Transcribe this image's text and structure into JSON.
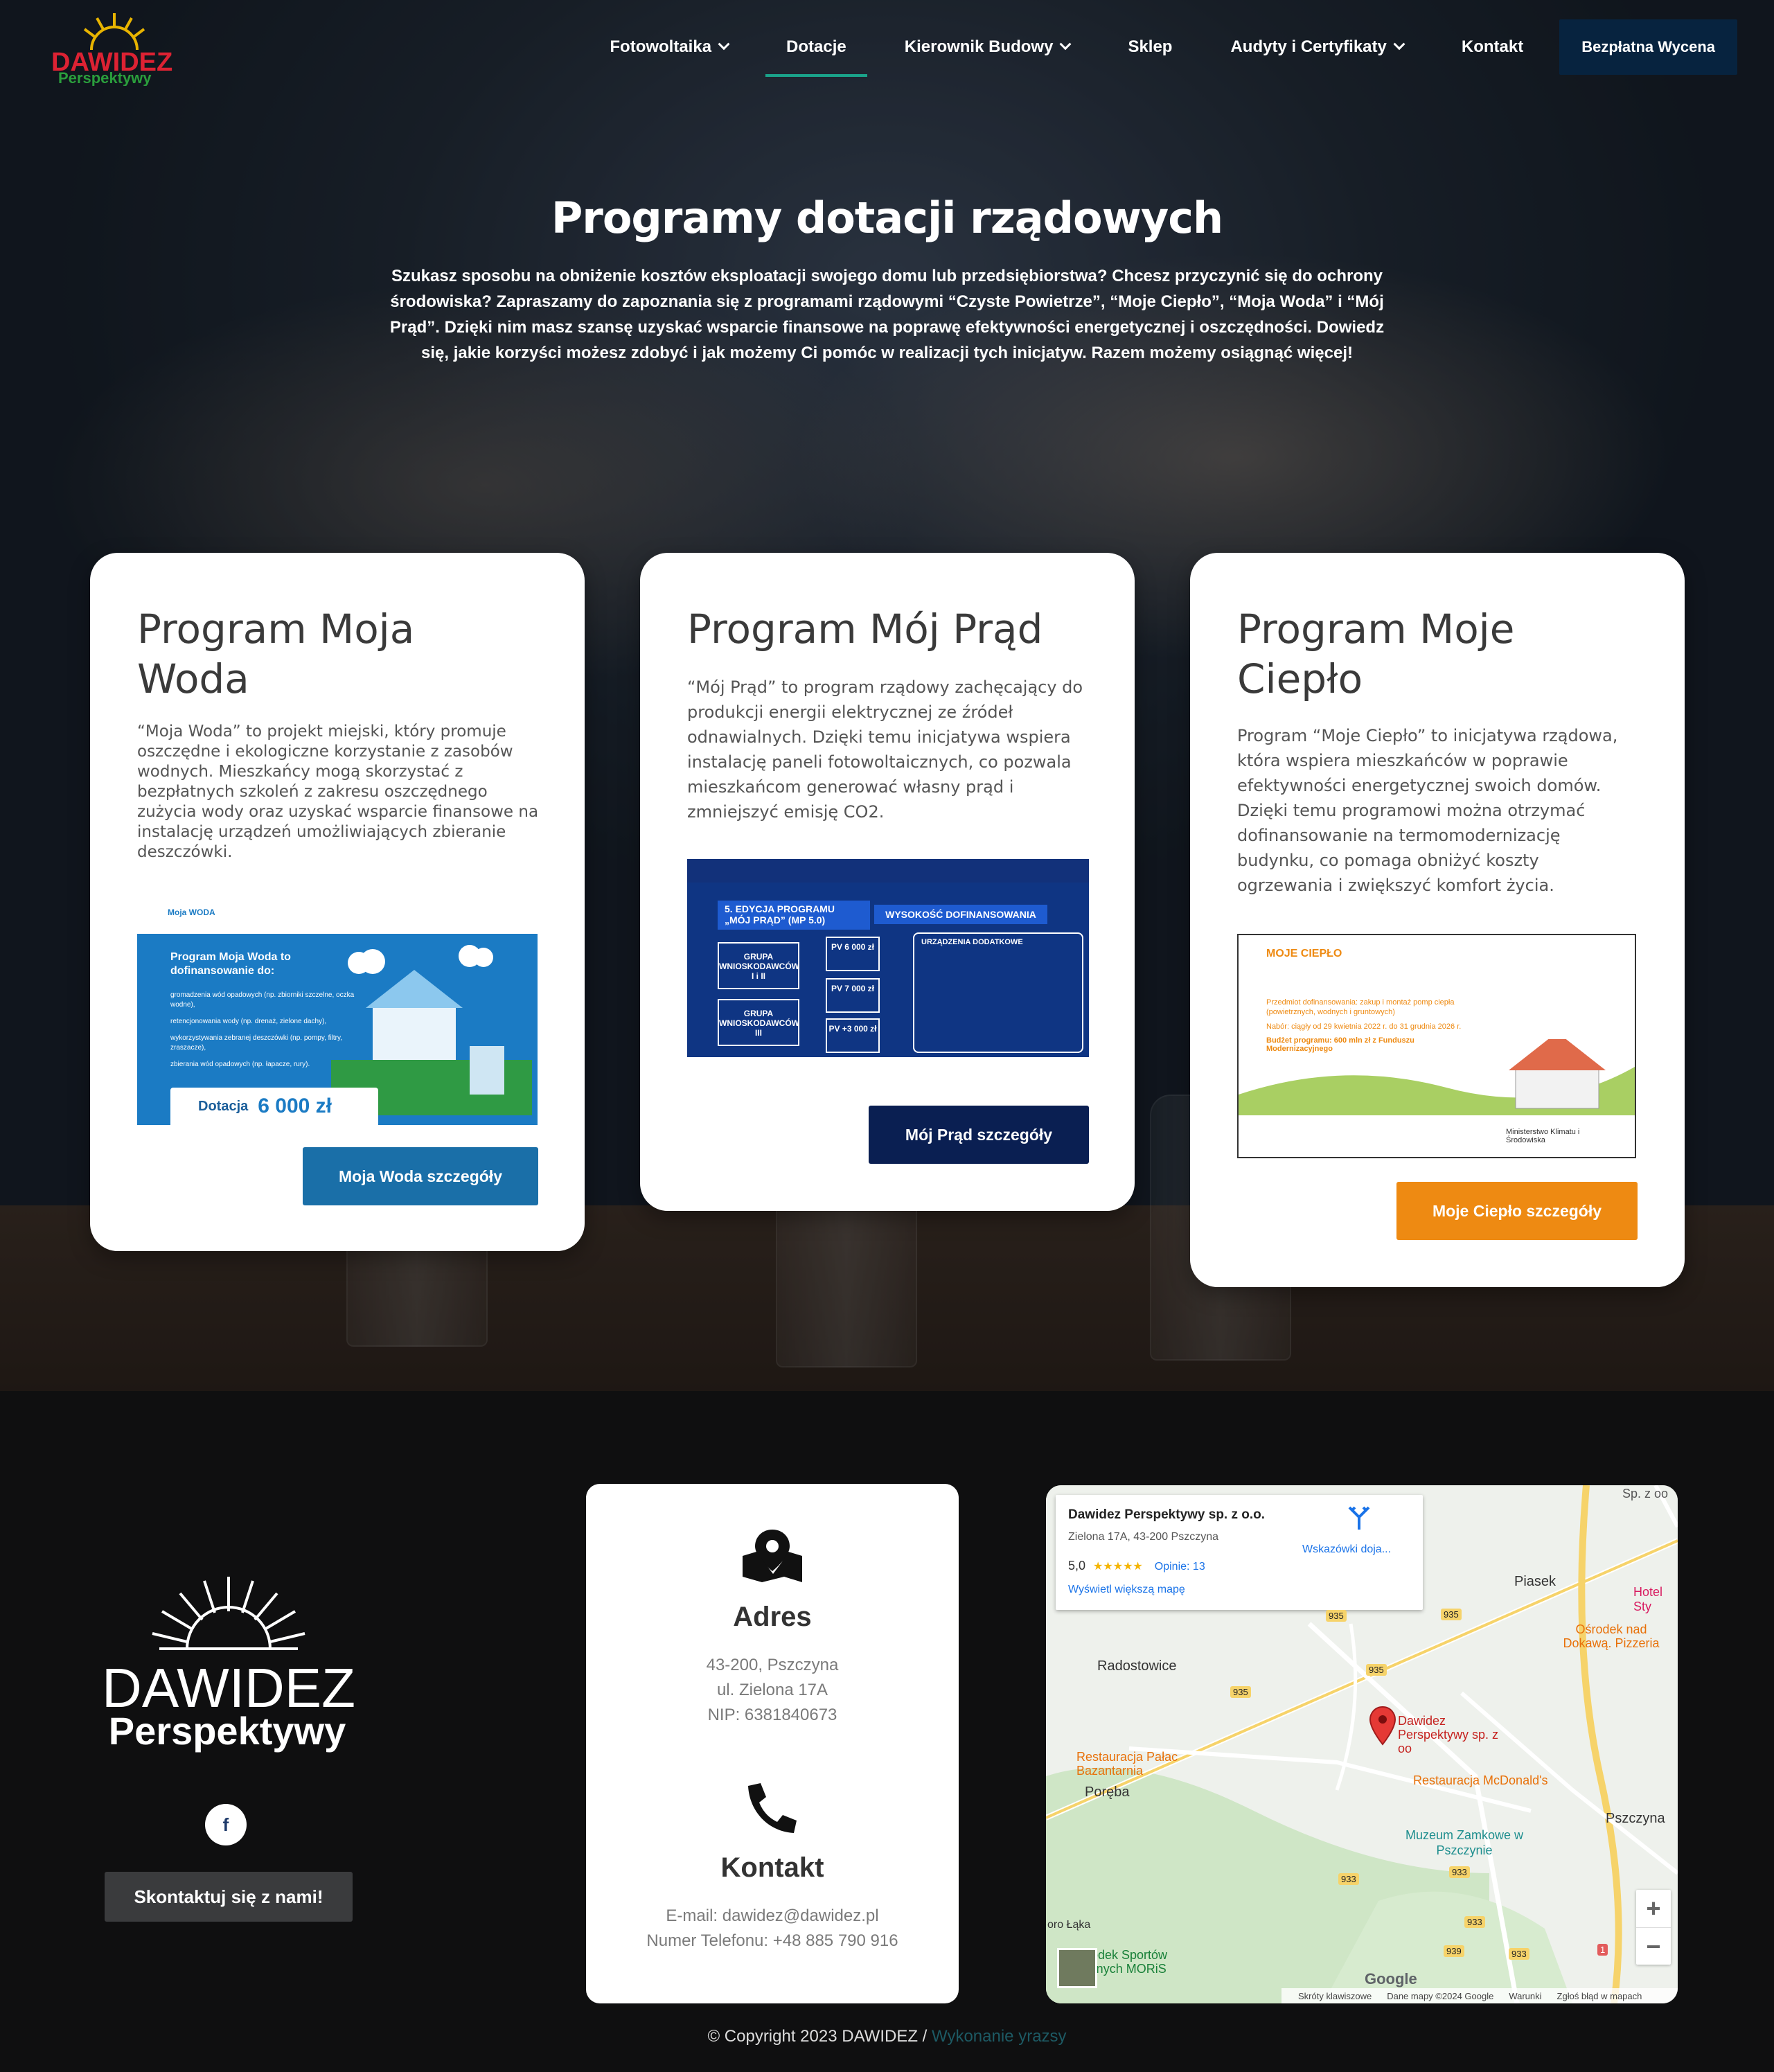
{
  "brand": {
    "name": "DAWIDEZ",
    "sub": "Perspektywy"
  },
  "nav": {
    "items": [
      {
        "label": "Fotowoltaika",
        "dropdown": true
      },
      {
        "label": "Dotacje",
        "dropdown": false,
        "active": true
      },
      {
        "label": "Kierownik Budowy",
        "dropdown": true
      },
      {
        "label": "Sklep",
        "dropdown": false
      },
      {
        "label": "Audyty i Certyfikaty",
        "dropdown": true
      },
      {
        "label": "Kontakt",
        "dropdown": false
      }
    ],
    "cta": "Bezpłatna Wycena"
  },
  "hero": {
    "title": "Programy dotacji rządowych",
    "description": "Szukasz sposobu na obniżenie kosztów eksploatacji swojego domu lub przedsiębiorstwa? Chcesz przyczynić się do ochrony środowiska? Zapraszamy do zapoznania się z programami rządowymi “Czyste Powietrze”, “Moje Ciepło”, “Moja Woda” i “Mój Prąd”. Dzięki nim masz szansę uzyskać wsparcie finansowe na poprawę efektywności energetycznej i oszczędności. Dowiedz się, jakie korzyści możesz zdobyć i jak możemy Ci pomóc w realizacji tych inicjatyw. Razem możemy osiągnąć więcej!"
  },
  "cards": {
    "woda": {
      "title": "Program Moja Woda",
      "text": "“Moja Woda” to projekt miejski, który promuje oszczędne i ekologiczne korzystanie z zasobów wodnych. Mieszkańcy mogą skorzystać z bezpłatnych szkoleń z zakresu oszczędnego zużycia wody oraz uzyskać wsparcie finansowe na instalację urządzeń umożliwiających zbieranie deszczówki.",
      "button": "Moja Woda szczegóły",
      "promo": {
        "logo": "Moja WODA",
        "heading": "Program Moja Woda to dofinansowanie do:",
        "bullets": [
          "gromadzenia wód opadowych (np. zbiorniki szczelne, oczka wodne),",
          "retencjonowania wody (np. drenaż, zielone dachy),",
          "wykorzystywania zebranej deszczówki (np. pompy, filtry, zraszacze),",
          "zbierania wód opadowych (np. łapacze, rury)."
        ],
        "grant_label": "Dotacja",
        "grant_value": "6 000 zł"
      },
      "color": "#1a6fa8"
    },
    "prad": {
      "title": "Program Mój Prąd",
      "text": "“Mój Prąd” to program rządowy zachęcający do produkcji energii elektrycznej ze źródeł odnawialnych. Dzięki temu inicjatywa wspiera instalację paneli fotowoltaicznych, co pozwala mieszkańcom generować własny prąd i zmniejszyć emisję CO2.",
      "button": "Mój Prąd szczegóły",
      "promo": {
        "edition": "5. EDYCJA PROGRAMU „MÓJ PRĄD” (MP 5.0)",
        "header": "WYSOKOŚĆ DOFINANSOWANIA",
        "group1": "GRUPA WNIOSKODAWCÓW I i II",
        "group2": "GRUPA WNIOSKODAWCÓW III",
        "pv1": "PV 6 000 zł",
        "pv2": "PV 7 000 zł",
        "pv3": "PV +3 000 zł",
        "devices": "URZĄDZENIA DODATKOWE"
      },
      "color": "#0a1f52"
    },
    "cieplo": {
      "title": "Program Moje Ciepło",
      "text": "Program “Moje Ciepło” to inicjatywa rządowa, która wspiera mieszkańców w poprawie efektywności energetycznej swoich domów. Dzięki temu programowi można otrzymać dofinansowanie na termomodernizację budynku, co pomaga obniżyć koszty ogrzewania i zwiększyć komfort życia.",
      "button": "Moje Ciepło szczegóły",
      "promo": {
        "logo": "MOJE CIEPŁO",
        "subject": "Przedmiot dofinansowania: zakup i montaż pomp ciepła (powietrznych, wodnych i gruntowych)",
        "recruit": "Nabór: ciągły od 29 kwietnia 2022 r. do 31 grudnia 2026 r.",
        "budget": "Budżet programu: 600 mln zł z Funduszu Modernizacyjnego",
        "ministry": "Ministerstwo Klimatu i Środowiska"
      },
      "color": "#ee8a12"
    }
  },
  "footer": {
    "brand": {
      "name": "DAWIDEZ",
      "sub": "Perspektywy"
    },
    "contact_button": "Skontaktuj się z nami!",
    "address": {
      "title": "Adres",
      "lines": [
        "43-200, Pszczyna",
        "ul. Zielona 17A",
        "NIP: 6381840673"
      ]
    },
    "contact": {
      "title": "Kontakt",
      "lines": [
        "E-mail: dawidez@dawidez.pl",
        "Numer Telefonu: +48 885 790 916"
      ]
    },
    "map": {
      "place": "Dawidez Perspektywy sp. z o.o.",
      "address": "Zielona 17A, 43-200 Pszczyna",
      "rating": "5,0",
      "stars": "★★★★★",
      "reviews": "Opinie: 13",
      "larger": "Wyświetl większą mapę",
      "directions": "Wskazówki doja...",
      "labels": {
        "radostowice": "Radostowice",
        "poreba": "Poręba",
        "piasek": "Piasek",
        "pszczyna": "Pszczyna",
        "marker": "Dawidez Perspektywy sp. z oo",
        "palac": "Restauracja Pałac Bazantarnia",
        "mcd": "Restauracja McDonald's",
        "muzeum": "Muzeum Zamkowe w Pszczynie",
        "hotel": "Hotel Sty",
        "osrodek": "Ośrodek nad Dokawą. Pizzeria",
        "sp": "Sp. z oo",
        "moris": "Ośrodek Sportów Wodnych MORiS",
        "laka": "oro Łąka"
      },
      "roads": [
        "935",
        "935",
        "935",
        "935",
        "933",
        "933",
        "933",
        "939",
        "933",
        "1"
      ],
      "attribution": {
        "keys": "Skróty klawiszowe",
        "data": "Dane mapy ©2024 Google",
        "terms": "Warunki",
        "report": "Zgłoś błąd w mapach"
      },
      "google": "Google",
      "zoom_in": "+",
      "zoom_out": "−"
    },
    "copyright": "© Copyright 2023 DAWIDEZ /",
    "credit": "Wykonanie yrazsy"
  },
  "icons": {
    "map": "map-icon",
    "phone": "phone-icon",
    "facebook": "facebook-icon",
    "chevron": "chevron-down-icon"
  }
}
